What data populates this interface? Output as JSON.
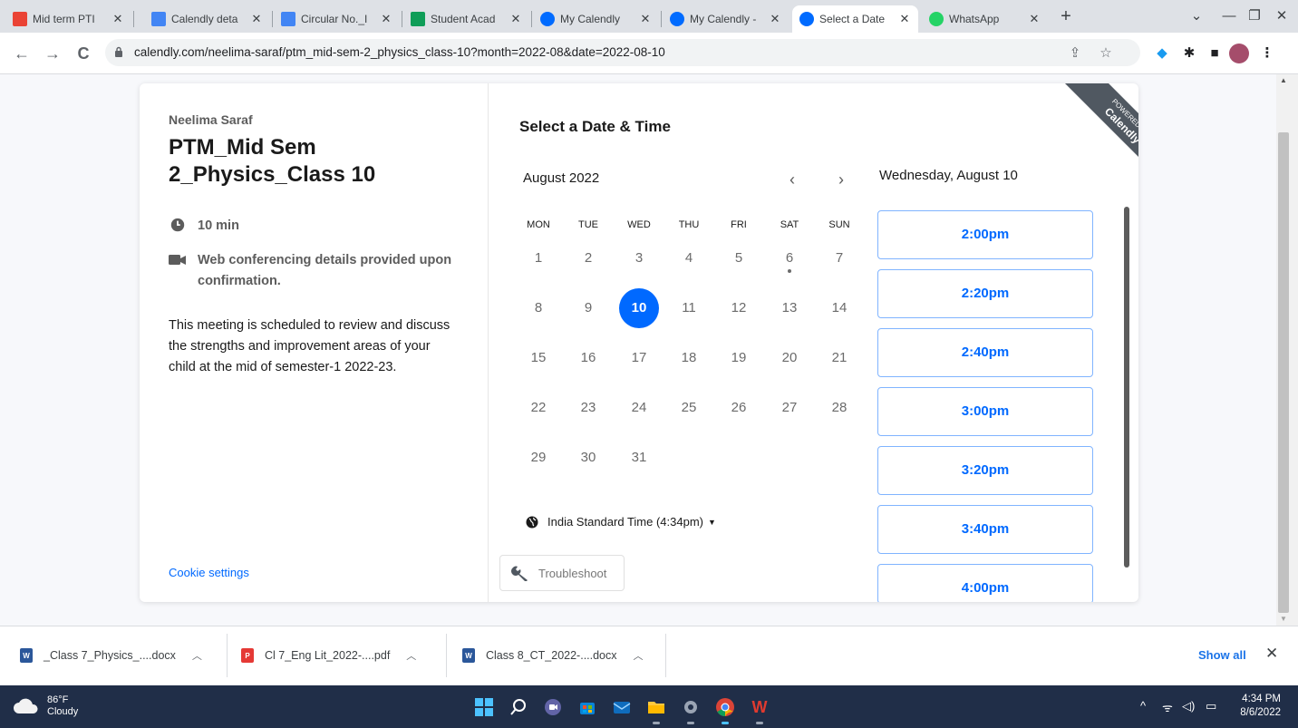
{
  "browser": {
    "tabs": [
      {
        "title": "Mid term PTI",
        "icon": "gmail-icon",
        "color": "#ea4335"
      },
      {
        "title": "Calendly deta",
        "icon": "docs-icon",
        "color": "#4285f4"
      },
      {
        "title": "Circular No._I",
        "icon": "docs-icon",
        "color": "#4285f4"
      },
      {
        "title": "Student Acad",
        "icon": "sheets-icon",
        "color": "#0f9d58"
      },
      {
        "title": "My Calendly",
        "icon": "calendly-icon",
        "color": "#006bff"
      },
      {
        "title": "My Calendly -",
        "icon": "calendly-icon",
        "color": "#006bff"
      },
      {
        "title": "Select a Date",
        "icon": "calendly-icon",
        "color": "#006bff"
      },
      {
        "title": "WhatsApp",
        "icon": "whatsapp-icon",
        "color": "#25d366"
      }
    ],
    "url": "calendly.com/neelima-saraf/ptm_mid-sem-2_physics_class-10?month=2022-08&date=2022-08-10"
  },
  "event": {
    "host": "Neelima Saraf",
    "title": "PTM_Mid Sem 2_Physics_Class 10",
    "duration": "10 min",
    "conferencing": "Web conferencing details provided upon confirmation.",
    "description": "This meeting is scheduled to review and discuss the strengths and improvement areas of your child at the mid of semester-1 2022-23.",
    "cookie_settings": "Cookie settings"
  },
  "scheduler": {
    "heading": "Select a Date & Time",
    "month": "August 2022",
    "weekdays": [
      "MON",
      "TUE",
      "WED",
      "THU",
      "FRI",
      "SAT",
      "SUN"
    ],
    "days": [
      "1",
      "2",
      "3",
      "4",
      "5",
      "6",
      "7",
      "8",
      "9",
      "10",
      "11",
      "12",
      "13",
      "14",
      "15",
      "16",
      "17",
      "18",
      "19",
      "20",
      "21",
      "22",
      "23",
      "24",
      "25",
      "26",
      "27",
      "28",
      "29",
      "30",
      "31"
    ],
    "selected_day": "10",
    "today_marker_day": "6",
    "timezone": "India Standard Time (4:34pm)",
    "troubleshoot": "Troubleshoot",
    "selected_date_label": "Wednesday, August 10",
    "time_slots": [
      "2:00pm",
      "2:20pm",
      "2:40pm",
      "3:00pm",
      "3:20pm",
      "3:40pm",
      "4:00pm"
    ],
    "badge": {
      "line1": "POWERED BY",
      "line2": "Calendly"
    },
    "accent": "#0069ff"
  },
  "downloads": {
    "items": [
      {
        "name": "_Class 7_Physics_....docx",
        "type": "word"
      },
      {
        "name": "Cl 7_Eng Lit_2022-....pdf",
        "type": "pdf"
      },
      {
        "name": "Class 8_CT_2022-....docx",
        "type": "word"
      }
    ],
    "show_all": "Show all"
  },
  "taskbar": {
    "temperature": "86°F",
    "condition": "Cloudy",
    "time": "4:34 PM",
    "date": "8/6/2022"
  }
}
